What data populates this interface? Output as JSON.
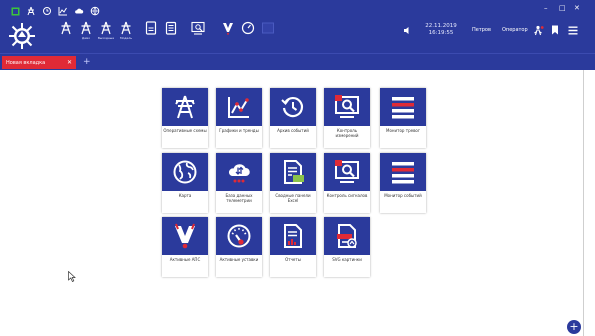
{
  "header": {
    "datetime": {
      "date": "22.11.2019",
      "time": "16:19:55"
    },
    "user": "Петров",
    "role": "Оператор",
    "window_controls": [
      "–",
      "□",
      "✕"
    ],
    "tool_captions": [
      "Демо",
      "Выходные",
      "Модель"
    ]
  },
  "tabs": {
    "active_label": "Новая вкладка",
    "close_glyph": "✕",
    "add_glyph": "+"
  },
  "tiles": [
    {
      "label": "Оперативные схемы",
      "icon": "substation-tower-icon"
    },
    {
      "label": "Графики и тренды",
      "icon": "line-chart-icon"
    },
    {
      "label": "Архив событий",
      "icon": "history-icon"
    },
    {
      "label": "Контроль измерений",
      "icon": "measurement-monitor-icon"
    },
    {
      "label": "Монитор тревог",
      "icon": "alarm-list-icon"
    },
    {
      "label": "Карта",
      "icon": "globe-icon"
    },
    {
      "label": "База данных телеметрии",
      "icon": "cloud-database-icon"
    },
    {
      "label": "Сводные панели Excel",
      "icon": "excel-document-icon"
    },
    {
      "label": "Контроль сигналов",
      "icon": "signal-monitor-icon"
    },
    {
      "label": "Монитор событий",
      "icon": "event-list-icon"
    },
    {
      "label": "Активные АПС",
      "icon": "alarm-flash-icon"
    },
    {
      "label": "Активные уставки",
      "icon": "gauge-icon"
    },
    {
      "label": "Отчеты",
      "icon": "report-icon"
    },
    {
      "label": "SVG картинки",
      "icon": "svg-image-icon"
    }
  ],
  "fab": {
    "glyph": "+"
  },
  "colors": {
    "brand": "#2b3a9c",
    "tab_active": "#e02a36",
    "accent_red": "#e02a36",
    "excel_green": "#8bc34a",
    "qa_green": "#3cc43c"
  }
}
